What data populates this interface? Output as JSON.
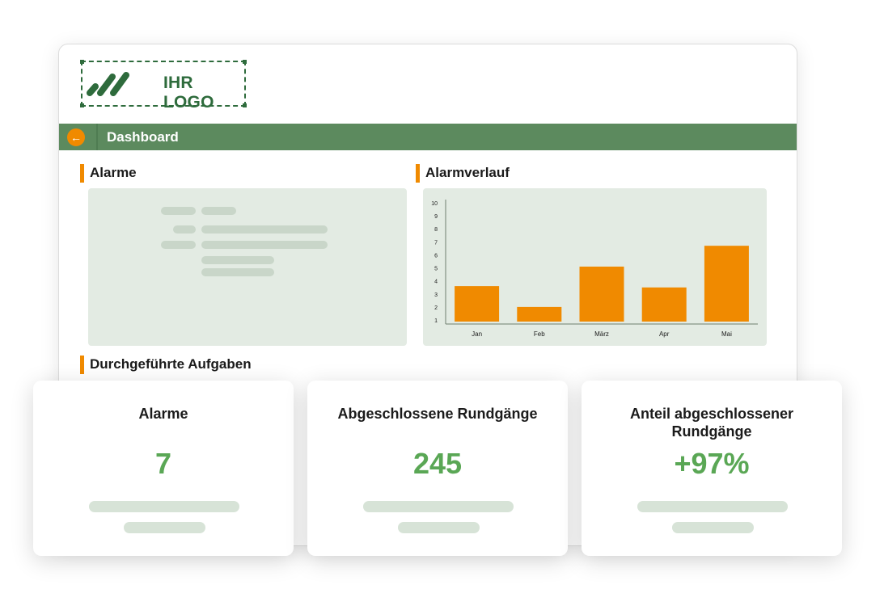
{
  "logo": {
    "text": "IHR LOGO"
  },
  "topbar": {
    "title": "Dashboard",
    "back_icon": "arrow-left-icon"
  },
  "sections": {
    "alarms": "Alarme",
    "history": "Alarmverlauf",
    "tasks": "Durchgeführte Aufgaben"
  },
  "colors": {
    "accent": "#f08a00",
    "brand_green": "#2e6b3c",
    "bar_green": "#5c8a5e",
    "value_green": "#5aa755"
  },
  "chart_data": {
    "type": "bar",
    "categories": [
      "Jan",
      "Feb",
      "März",
      "Apr",
      "Mai"
    ],
    "values": [
      3.6,
      2.0,
      5.1,
      3.5,
      6.7
    ],
    "yticks": [
      1,
      2,
      3,
      4,
      5,
      6,
      7,
      8,
      9,
      10
    ],
    "ylim": [
      1,
      10
    ],
    "bar_color": "#f08a00",
    "title": "",
    "xlabel": "",
    "ylabel": ""
  },
  "cards": [
    {
      "title": "Alarme",
      "value": "7"
    },
    {
      "title": "Abgeschlossene Rundgänge",
      "value": "245"
    },
    {
      "title": "Anteil abgeschlossener Rundgänge",
      "value": "+97%"
    }
  ]
}
